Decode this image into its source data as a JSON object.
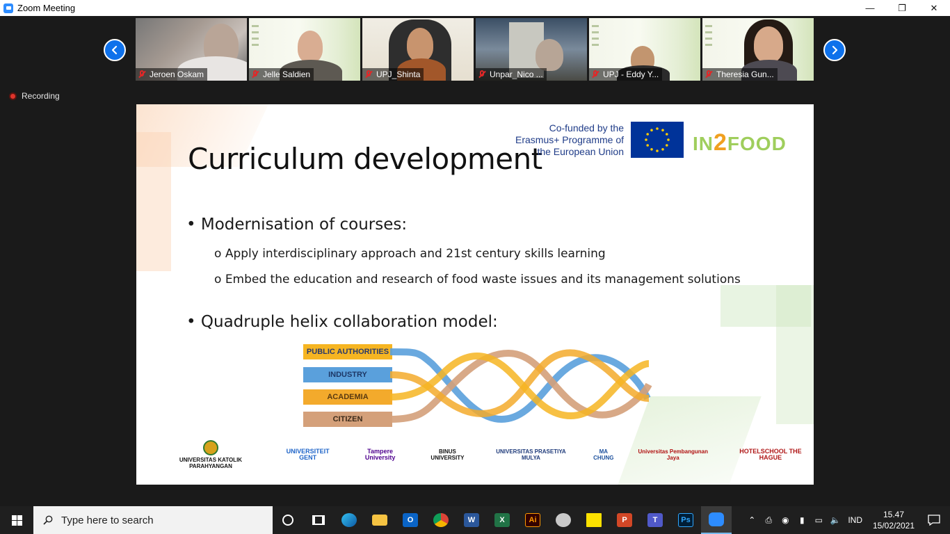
{
  "window": {
    "title": "Zoom Meeting",
    "minimize": "—",
    "restore": "❐",
    "close": "✕"
  },
  "participants": [
    {
      "name": "Jeroen Oskam"
    },
    {
      "name": "Jelle Saldien"
    },
    {
      "name": "UPJ_Shinta"
    },
    {
      "name": "Unpar_Nico ..."
    },
    {
      "name": "UPJ - Eddy Y..."
    },
    {
      "name": "Theresia Gun..."
    }
  ],
  "recording": {
    "label": "Recording"
  },
  "slide": {
    "title": "Curriculum development",
    "cofunded": "Co-funded by the Erasmus+ Programme of the European Union",
    "brand": {
      "pre": "IN",
      "two": "2",
      "post": "FOOD"
    },
    "bullet1": "Modernisation of courses:",
    "sub1": "Apply interdisciplinary approach and 21st century skills learning",
    "sub2": "Embed the education and research of food waste issues and its management solutions",
    "bullet2": "Quadruple helix collaboration model:",
    "helix": {
      "labels": [
        "PUBLIC AUTHORITIES",
        "INDUSTRY",
        "ACADEMIA",
        "CITIZEN"
      ],
      "colors": [
        "#f6b522",
        "#5aa0dc",
        "#f3aa2c",
        "#d4a07a"
      ]
    },
    "logos": {
      "ukp": "UNIVERSITAS KATOLIK PARAHYANGAN",
      "ugent": "UNIVERSITEIT GENT",
      "tampere": "Tampere University",
      "binus": "BINUS UNIVERSITY",
      "pm": "UNIVERSITAS PRASETIYA MULYA",
      "machung": "MA CHUNG",
      "upj": "Universitas Pembangunan Jaya",
      "hth": "HOTELSCHOOL THE HAGUE"
    }
  },
  "taskbar": {
    "search_placeholder": "Type here to search",
    "apps": [
      "cortana",
      "task-view",
      "edge",
      "file-explorer",
      "outlook",
      "chrome",
      "word",
      "excel",
      "illustrator",
      "app",
      "sticky-notes",
      "powerpoint",
      "teams",
      "photoshop",
      "zoom"
    ],
    "language": "IND",
    "time": "15.47",
    "date": "15/02/2021"
  }
}
